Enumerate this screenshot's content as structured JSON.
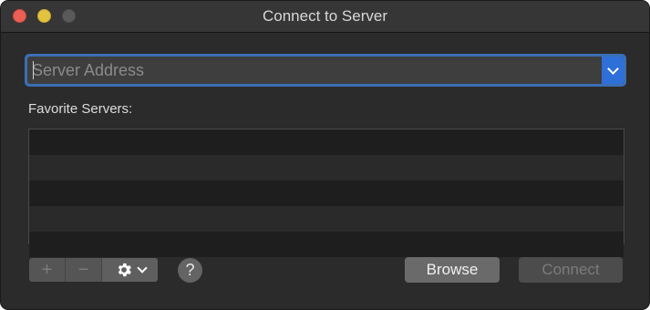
{
  "window": {
    "title": "Connect to Server"
  },
  "server_address": {
    "placeholder": "Server Address",
    "value": ""
  },
  "favorites": {
    "label": "Favorite Servers:",
    "items": []
  },
  "toolbar": {
    "add_label": "+",
    "remove_label": "−",
    "action_icon": "gear-icon",
    "help_label": "?"
  },
  "buttons": {
    "browse_label": "Browse",
    "connect_label": "Connect",
    "connect_enabled": false
  },
  "colors": {
    "accent": "#2f6fd8",
    "focus_ring": "#3a6fb4",
    "close": "#ec5f56",
    "minimize": "#e3c23f",
    "zoom_disabled": "#5a5a5a"
  }
}
